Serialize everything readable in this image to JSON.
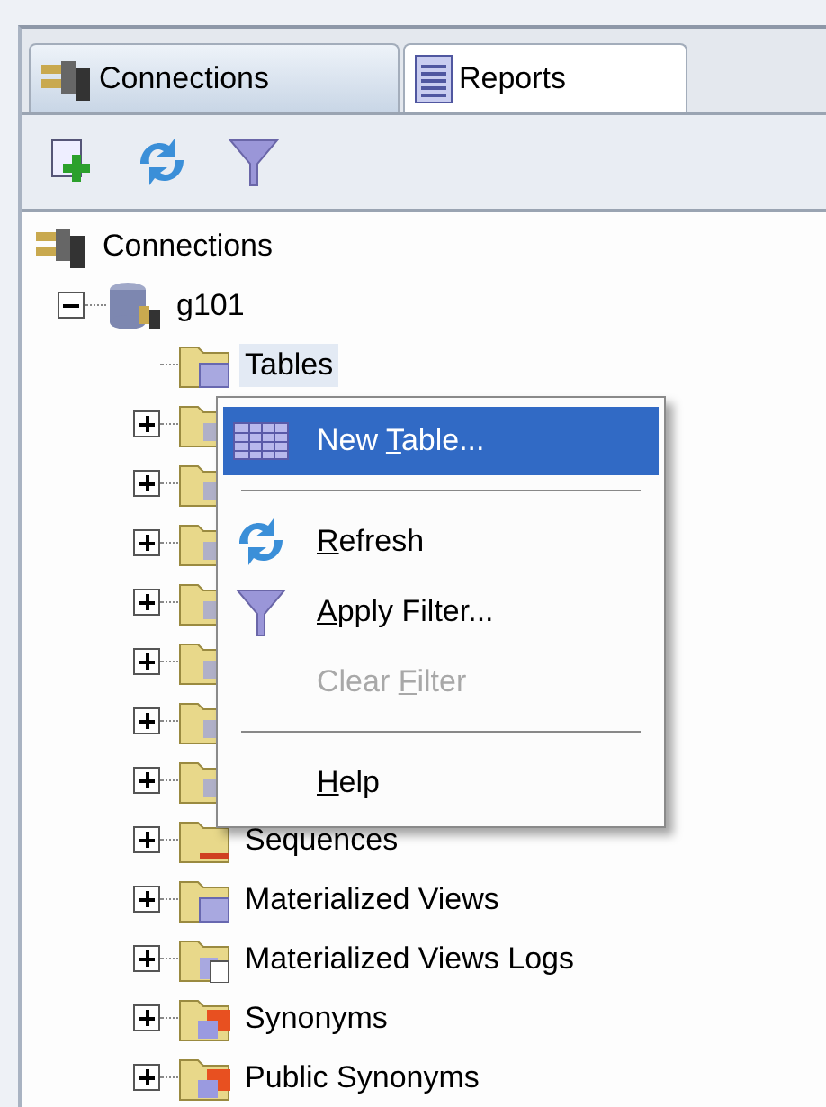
{
  "tabs": [
    {
      "label": "Connections",
      "selected": true
    },
    {
      "label": "Reports",
      "selected": false
    }
  ],
  "toolbar": [
    {
      "kind": "add"
    },
    {
      "kind": "refresh"
    },
    {
      "kind": "filter"
    }
  ],
  "tree": {
    "label": "Connections",
    "children": [
      {
        "label": "g101",
        "expanded": true,
        "children": [
          {
            "label": "Tables",
            "highlighted": true
          },
          {
            "expanded": false
          },
          {
            "expanded": false
          },
          {
            "expanded": false
          },
          {
            "expanded": false
          },
          {
            "expanded": false
          },
          {
            "expanded": false
          },
          {
            "expanded": false
          },
          {
            "label": "Sequences",
            "highlighted": false,
            "expanded": false
          },
          {
            "label": "Materialized Views",
            "highlighted": false,
            "expanded": false
          },
          {
            "label": "Materialized Views Logs",
            "highlighted": false,
            "expanded": false
          },
          {
            "label": "Synonyms",
            "highlighted": false,
            "expanded": false
          },
          {
            "label": "Public Synonyms",
            "highlighted": false,
            "expanded": false
          }
        ]
      }
    ]
  },
  "context_menu": [
    {
      "kind": "item",
      "before": "New ",
      "mnemonic": "T",
      "after": "able...",
      "selected": true,
      "disabled": false
    },
    {
      "kind": "separator"
    },
    {
      "kind": "item",
      "mnemonic": "R",
      "after": "efresh",
      "selected": false,
      "disabled": false
    },
    {
      "kind": "item",
      "mnemonic": "A",
      "after": "pply Filter...",
      "selected": false,
      "disabled": false
    },
    {
      "kind": "item",
      "before": "Clear ",
      "mnemonic": "F",
      "after": "ilter",
      "selected": false,
      "disabled": true
    },
    {
      "kind": "separator"
    },
    {
      "kind": "item",
      "mnemonic": "H",
      "after": "elp",
      "selected": false,
      "disabled": false
    }
  ]
}
